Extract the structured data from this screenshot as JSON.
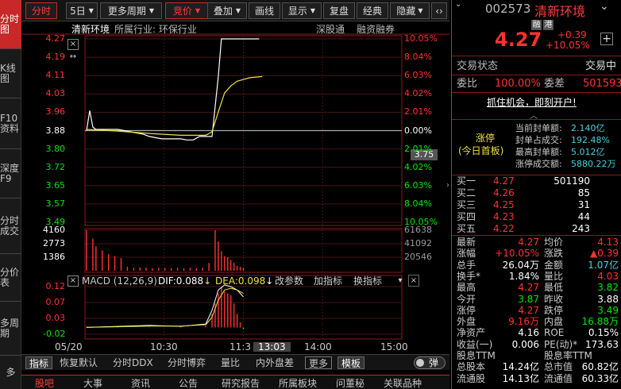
{
  "left_tabs": [
    "分时图",
    "K线图",
    "F10资料",
    "深度F9",
    "分时成交",
    "分价表",
    "多周期",
    "多"
  ],
  "toolbar": {
    "tab_fenshi": "分时",
    "period": "5日",
    "more_period": "更多周期",
    "price_type": "竞价",
    "overlay": "叠加",
    "draw_line": "画线",
    "display": "显示",
    "replay": "复盘",
    "classic": "经典",
    "hide": "隐藏",
    "arrows": "‹›",
    "close": "×"
  },
  "chart_header": {
    "name": "清新环境",
    "industry": "所属行业: 环保行业",
    "link1": "深股通",
    "link2": "融资融券"
  },
  "price_axis": {
    "left": [
      "4.27",
      "4.19",
      "4.11",
      "4.03",
      "3.96",
      "3.88",
      "3.80",
      "3.72",
      "3.65",
      "3.57",
      "3.49"
    ],
    "right": [
      "10.05%",
      "8.04%",
      "6.03%",
      "4.02%",
      "2.01%",
      "0.00%",
      "2.01%",
      "4.02%",
      "6.03%",
      "8.04%",
      "10.05%"
    ],
    "crosshair_value": "3.75"
  },
  "volume_axis": {
    "left": [
      "4160",
      "2773",
      "1386"
    ],
    "right": [
      "61638",
      "41092",
      "20546"
    ]
  },
  "macd": {
    "label": "MACD (12,26,9)",
    "dif": "DIF:0.088",
    "dea": "DEA:0.098",
    "change_param": "改参数",
    "add_indicator": "加指标",
    "switch_indicator": "换指标",
    "axis": [
      "0.12",
      "0.07",
      "0.03",
      "-0.02"
    ]
  },
  "time_axis": {
    "labels": [
      "05/20",
      "10:30",
      "11:3",
      "13:03",
      "14:00",
      "15:00"
    ]
  },
  "bottom_tabs": [
    "指标",
    "恢复默认",
    "分时DDX",
    "分时博弈",
    "量比",
    "内外盘差",
    "更多",
    "模板",
    "弹"
  ],
  "news_tabs": [
    "股吧",
    "大事",
    "资讯",
    "公告",
    "研究报告",
    "所属板块",
    "问董秘",
    "关联品种"
  ],
  "stock": {
    "code": "002573",
    "name": "清新环境",
    "badge1": "融",
    "badge2": "港",
    "price": "4.27",
    "change": "+0.39",
    "change_pct": "+10.05%",
    "plus": "+"
  },
  "status": {
    "trade_status_label": "交易状态",
    "trade_status_value": "交易中",
    "wb_label": "委比",
    "wb_value": "100.00%",
    "wc_label": "委差",
    "wc_value": "501593",
    "banner": "抓住机会，即刻开户!"
  },
  "limit_up": {
    "title": "涨停",
    "subtitle": "(今日首板)",
    "items": [
      {
        "label": "当前封单额:",
        "value": "2.140亿"
      },
      {
        "label": "封单占成交:",
        "value": "192.48%"
      },
      {
        "label": "最高封单额:",
        "value": "5.012亿"
      },
      {
        "label": "涨停成交额:",
        "value": "5880.22万"
      }
    ]
  },
  "orders": {
    "sell": [
      {
        "label": "卖五",
        "price": "",
        "volume": ""
      },
      {
        "label": "卖四",
        "price": "",
        "volume": ""
      },
      {
        "label": "卖三",
        "price": "",
        "volume": ""
      },
      {
        "label": "卖二",
        "price": "",
        "volume": ""
      },
      {
        "label": "卖一",
        "price": "",
        "volume": ""
      }
    ],
    "buy": [
      {
        "label": "买一",
        "price": "4.27",
        "volume": "501190"
      },
      {
        "label": "买二",
        "price": "4.26",
        "volume": "85"
      },
      {
        "label": "买三",
        "price": "4.25",
        "volume": "31"
      },
      {
        "label": "买四",
        "price": "4.23",
        "volume": "44"
      },
      {
        "label": "买五",
        "price": "4.22",
        "volume": "243"
      }
    ]
  },
  "quote": [
    {
      "l1": "最新",
      "v1": "4.27",
      "c1": "red",
      "l2": "均价",
      "v2": "4.13",
      "c2": "red"
    },
    {
      "l1": "涨幅",
      "v1": "+10.05%",
      "c1": "red",
      "l2": "涨跌",
      "v2": "▲0.39",
      "c2": "red"
    },
    {
      "l1": "总手",
      "v1": "26.04万",
      "c1": "wht",
      "l2": "金额",
      "v2": "1.07亿",
      "c2": "cyn"
    },
    {
      "l1": "换手*",
      "v1": "1.84%",
      "c1": "wht",
      "l2": "量比",
      "v2": "4.03",
      "c2": "red"
    },
    {
      "l1": "最高",
      "v1": "4.27",
      "c1": "red",
      "l2": "最低",
      "v2": "3.82",
      "c2": "grn"
    },
    {
      "l1": "今开",
      "v1": "3.87",
      "c1": "grn",
      "l2": "昨收",
      "v2": "3.88",
      "c2": "wht"
    },
    {
      "l1": "涨停",
      "v1": "4.27",
      "c1": "red",
      "l2": "跌停",
      "v2": "3.49",
      "c2": "grn"
    },
    {
      "l1": "外盘",
      "v1": "9.16万",
      "c1": "red",
      "l2": "内盘",
      "v2": "16.88万",
      "c2": "grn"
    },
    {
      "l1": "净资产",
      "v1": "4.16",
      "c1": "wht",
      "l2": "ROE",
      "v2": "0.15%",
      "c2": "wht"
    },
    {
      "l1": "收益(一)",
      "v1": "0.006",
      "c1": "wht",
      "l2": "PE(动)*",
      "v2": "173.63",
      "c2": "wht"
    },
    {
      "l1": "股息TTM",
      "v1": "",
      "c1": "wht",
      "l2": "股息率TTM",
      "v2": "",
      "c2": "wht"
    },
    {
      "l1": "总股本",
      "v1": "14.24亿",
      "c1": "wht",
      "l2": "总市值",
      "v2": "60.82亿",
      "c2": "wht"
    },
    {
      "l1": "流通股",
      "v1": "14.13亿",
      "c1": "wht",
      "l2": "流通值",
      "v2": "60.33亿",
      "c2": "wht"
    }
  ],
  "colors": {
    "up": "#ff3232",
    "down": "#00e600",
    "price_line": "#ffffff",
    "avg_line": "#f0e040",
    "accent": "#c82828"
  },
  "chart_data": {
    "type": "line",
    "price_series": [
      [
        0,
        3.88
      ],
      [
        1,
        3.965
      ],
      [
        2,
        3.895
      ],
      [
        3,
        3.885
      ],
      [
        5,
        3.885
      ],
      [
        8,
        3.885
      ],
      [
        10,
        3.885
      ],
      [
        12,
        3.88
      ],
      [
        14,
        3.875
      ],
      [
        16,
        3.87
      ],
      [
        18,
        3.865
      ],
      [
        20,
        3.855
      ],
      [
        22,
        3.85
      ],
      [
        24,
        3.845
      ],
      [
        26,
        3.845
      ],
      [
        28,
        3.845
      ],
      [
        30,
        3.845
      ],
      [
        32,
        3.84
      ],
      [
        34,
        3.84
      ],
      [
        36,
        3.855
      ],
      [
        38,
        3.855
      ],
      [
        40,
        3.855
      ],
      [
        42,
        4.11
      ],
      [
        43,
        4.27
      ],
      [
        48,
        4.27
      ],
      [
        52,
        4.27
      ],
      [
        55,
        4.27
      ]
    ],
    "avg_series": [
      [
        0,
        3.885
      ],
      [
        10,
        3.878
      ],
      [
        20,
        3.868
      ],
      [
        30,
        3.86
      ],
      [
        38,
        3.86
      ],
      [
        40,
        3.875
      ],
      [
        42,
        3.96
      ],
      [
        44,
        4.04
      ],
      [
        46,
        4.07
      ],
      [
        48,
        4.09
      ],
      [
        52,
        4.105
      ],
      [
        56,
        4.11
      ]
    ],
    "ylim": [
      3.49,
      4.27
    ],
    "prev_close": 3.88,
    "volume": [
      [
        0,
        4160
      ],
      [
        2,
        3300
      ],
      [
        3,
        2500
      ],
      [
        5,
        2100
      ],
      [
        7,
        1700
      ],
      [
        9,
        1500
      ],
      [
        11,
        1300
      ],
      [
        13,
        400
      ],
      [
        15,
        300
      ],
      [
        17,
        350
      ],
      [
        19,
        300
      ],
      [
        21,
        250
      ],
      [
        23,
        300
      ],
      [
        25,
        280
      ],
      [
        27,
        260
      ],
      [
        29,
        300
      ],
      [
        31,
        250
      ],
      [
        33,
        300
      ],
      [
        35,
        260
      ],
      [
        37,
        300
      ],
      [
        39,
        800
      ],
      [
        41,
        4160
      ],
      [
        42,
        3000
      ],
      [
        43,
        2000
      ],
      [
        44,
        1500
      ],
      [
        45,
        1386
      ],
      [
        46,
        1100
      ],
      [
        47,
        800
      ],
      [
        48,
        500
      ],
      [
        49,
        400
      ],
      [
        50,
        300
      ]
    ],
    "volume_ylim": [
      0,
      4160
    ],
    "macd_hist": [
      [
        0,
        0.003
      ],
      [
        5,
        0.002
      ],
      [
        10,
        0.002
      ],
      [
        20,
        0.001
      ],
      [
        30,
        0.002
      ],
      [
        38,
        0.005
      ],
      [
        40,
        0.04
      ],
      [
        41,
        0.07
      ],
      [
        42,
        0.1
      ],
      [
        43,
        0.12
      ],
      [
        44,
        0.105
      ],
      [
        45,
        0.1
      ],
      [
        46,
        0.095
      ],
      [
        47,
        0.07
      ],
      [
        48,
        0.04
      ],
      [
        49,
        0.015
      ],
      [
        50,
        -0.005
      ]
    ],
    "macd_dif": [
      [
        0,
        0
      ],
      [
        10,
        0.003
      ],
      [
        20,
        0.006
      ],
      [
        30,
        0.003
      ],
      [
        38,
        0.01
      ],
      [
        40,
        0.05
      ],
      [
        42,
        0.11
      ],
      [
        44,
        0.125
      ],
      [
        46,
        0.12
      ],
      [
        48,
        0.11
      ],
      [
        50,
        0.09
      ]
    ],
    "macd_dea": [
      [
        0,
        0
      ],
      [
        10,
        0.002
      ],
      [
        20,
        0.004
      ],
      [
        30,
        0.004
      ],
      [
        38,
        0.008
      ],
      [
        40,
        0.03
      ],
      [
        42,
        0.08
      ],
      [
        44,
        0.11
      ],
      [
        46,
        0.115
      ],
      [
        48,
        0.11
      ],
      [
        50,
        0.1
      ]
    ],
    "macd_ylim": [
      -0.02,
      0.12
    ],
    "x_count": 100
  }
}
